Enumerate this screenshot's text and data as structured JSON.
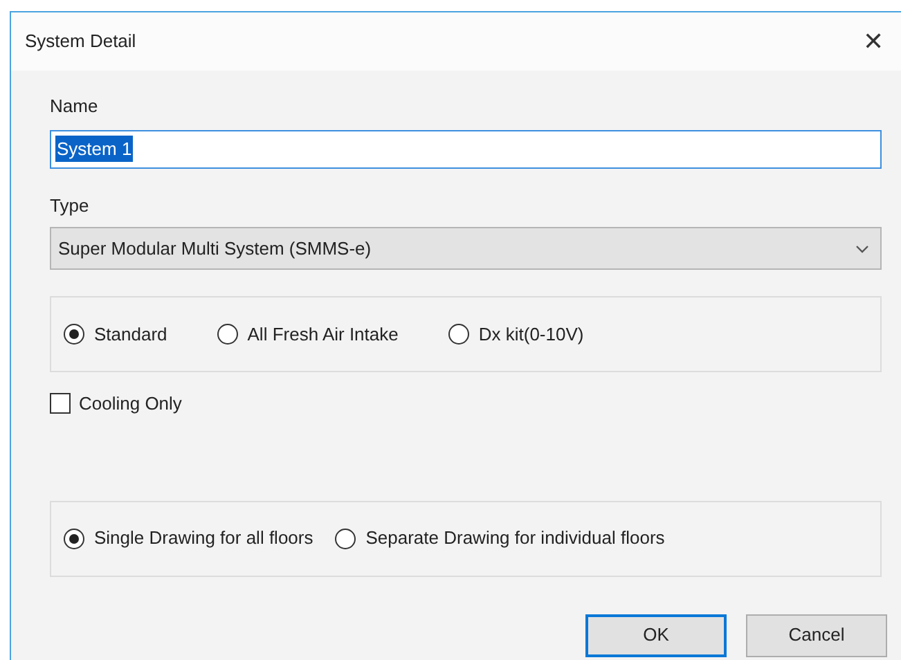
{
  "window": {
    "title": "System Detail",
    "close": "✕"
  },
  "name_field": {
    "label": "Name",
    "value": "System 1",
    "text_selected": true
  },
  "type_field": {
    "label": "Type",
    "value": "Super Modular Multi System (SMMS-e)"
  },
  "system_options": [
    {
      "label": "Standard",
      "selected": true
    },
    {
      "label": "All Fresh Air Intake",
      "selected": false
    },
    {
      "label": "Dx kit(0-10V)",
      "selected": false
    }
  ],
  "cooling_only": {
    "label": "Cooling Only",
    "checked": false
  },
  "drawing_options": [
    {
      "label": "Single Drawing for all floors",
      "selected": true
    },
    {
      "label": "Separate Drawing for individual floors",
      "selected": false
    }
  ],
  "buttons": [
    {
      "label": "OK",
      "default": true
    },
    {
      "label": "Cancel",
      "default": false
    }
  ]
}
